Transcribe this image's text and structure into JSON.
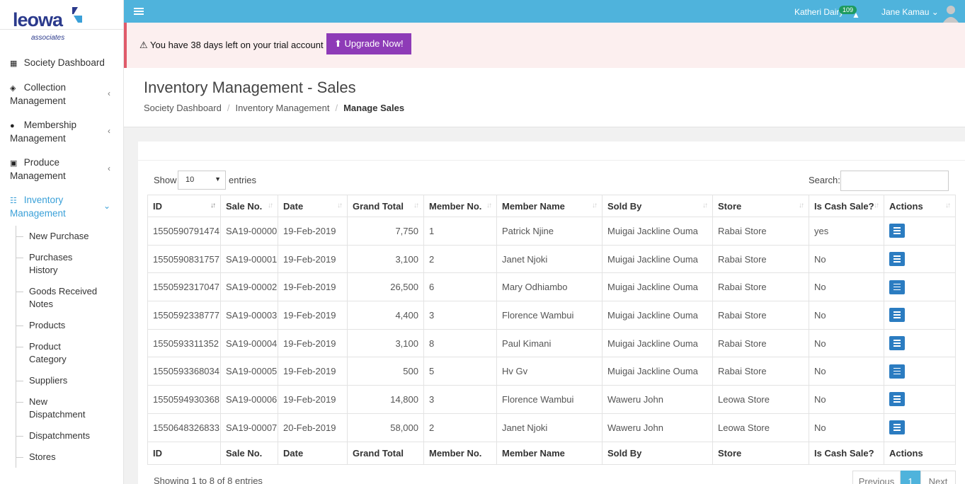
{
  "brand": {
    "name": "leowa",
    "sub": "associates"
  },
  "sidebar": {
    "items": [
      {
        "label": "Society Dashboard",
        "icon": "grid-icon"
      },
      {
        "label": "Collection",
        "label2": "Management",
        "icon": "layers-icon"
      },
      {
        "label": "Membership",
        "label2": "Management",
        "icon": "users-icon"
      },
      {
        "label": "Produce",
        "label2": "Management",
        "icon": "id-card-icon"
      },
      {
        "label": "Inventory",
        "label2": "Management",
        "icon": "cart-icon"
      }
    ],
    "sub_items": [
      {
        "label": "New Purchase"
      },
      {
        "label": "Purchases",
        "label2": "History"
      },
      {
        "label": "Goods Received",
        "label2": "Notes"
      },
      {
        "label": "Products"
      },
      {
        "label": "Product",
        "label2": "Category"
      },
      {
        "label": "Suppliers"
      },
      {
        "label": "New",
        "label2": "Dispatchment"
      },
      {
        "label": "Dispatchments"
      },
      {
        "label": "Stores"
      }
    ]
  },
  "topbar": {
    "org": "Katheri Dairy",
    "badge": "109",
    "user": "Jane Kamau"
  },
  "alert": {
    "message": "You have 38 days left on your trial account",
    "button": "Upgrade Now!"
  },
  "header": {
    "title": "Inventory Management - Sales",
    "breadcrumb": [
      "Society Dashboard",
      "Inventory Management",
      "Manage Sales"
    ]
  },
  "table_controls": {
    "show": "Show",
    "length": "10",
    "entries": "entries",
    "search": "Search:"
  },
  "table": {
    "columns": [
      "ID",
      "Sale No.",
      "Date",
      "Grand Total",
      "Member No.",
      "Member Name",
      "Sold By",
      "Store",
      "Is Cash Sale?",
      "Actions"
    ],
    "rows": [
      [
        "1550590791474",
        "SA19-00000",
        "19-Feb-2019",
        "7,750",
        "1",
        "Patrick Njine",
        "Muigai Jackline Ouma",
        "Rabai Store",
        "yes"
      ],
      [
        "1550590831757",
        "SA19-00001",
        "19-Feb-2019",
        "3,100",
        "2",
        "Janet Njoki",
        "Muigai Jackline Ouma",
        "Rabai Store",
        "No"
      ],
      [
        "1550592317047",
        "SA19-00002",
        "19-Feb-2019",
        "26,500",
        "6",
        "Mary Odhiambo",
        "Muigai Jackline Ouma",
        "Rabai Store",
        "No"
      ],
      [
        "1550592338777",
        "SA19-00003",
        "19-Feb-2019",
        "4,400",
        "3",
        "Florence Wambui",
        "Muigai Jackline Ouma",
        "Rabai Store",
        "No"
      ],
      [
        "1550593311352",
        "SA19-00004",
        "19-Feb-2019",
        "3,100",
        "8",
        "Paul Kimani",
        "Muigai Jackline Ouma",
        "Rabai Store",
        "No"
      ],
      [
        "1550593368034",
        "SA19-00005",
        "19-Feb-2019",
        "500",
        "5",
        "Hv Gv",
        "Muigai Jackline Ouma",
        "Rabai Store",
        "No"
      ],
      [
        "1550594930368",
        "SA19-00006",
        "19-Feb-2019",
        "14,800",
        "3",
        "Florence Wambui",
        "Waweru John",
        "Leowa Store",
        "No"
      ],
      [
        "1550648326833",
        "SA19-00007",
        "20-Feb-2019",
        "58,000",
        "2",
        "Janet Njoki",
        "Waweru John",
        "Leowa Store",
        "No"
      ]
    ]
  },
  "footer": {
    "info": "Showing 1 to 8 of 8 entries",
    "prev": "Previous",
    "page": "1",
    "next": "Next"
  },
  "colors": {
    "topbar": "#4fb3dc",
    "accent": "#3aa0d8",
    "upgrade": "#8e3bb7",
    "action": "#2b7cc1"
  }
}
